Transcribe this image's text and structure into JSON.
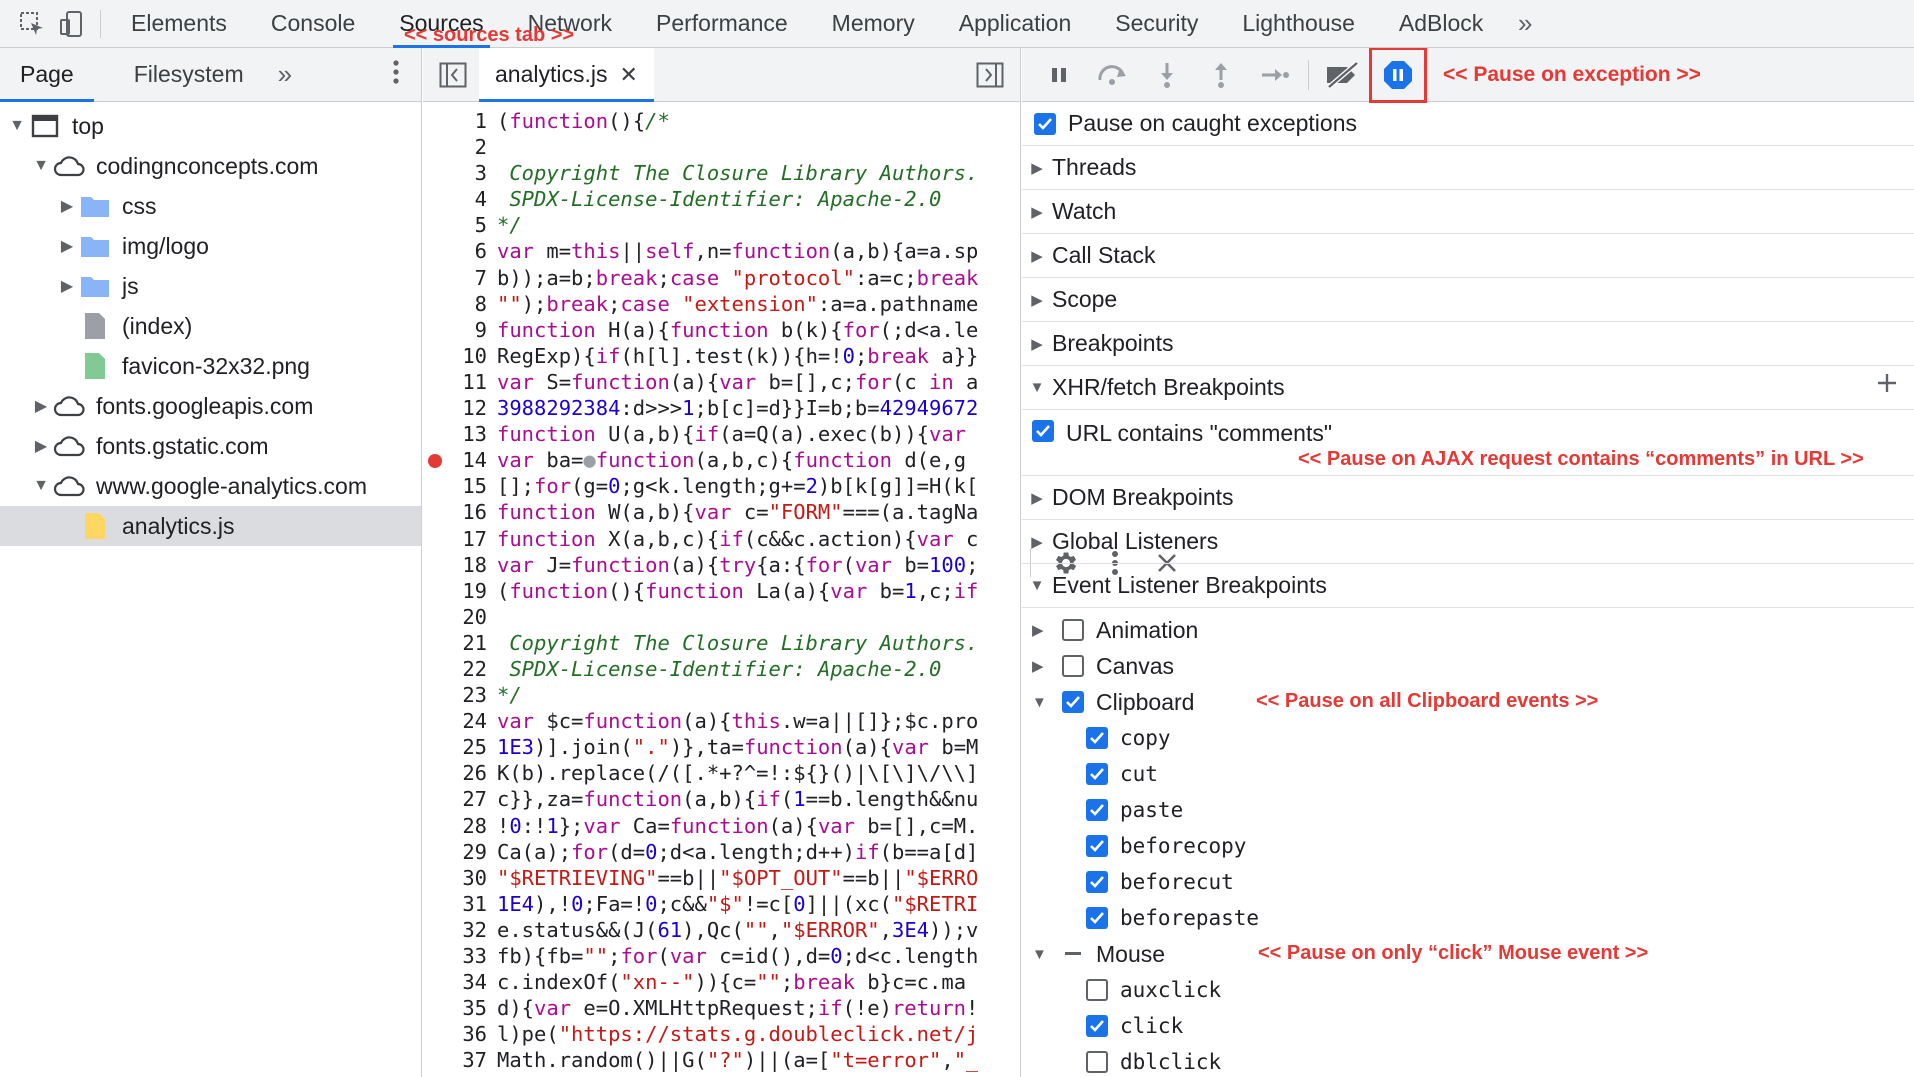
{
  "toolbar": {
    "tabs": [
      "Elements",
      "Console",
      "Sources",
      "Network",
      "Performance",
      "Memory",
      "Application",
      "Security",
      "Lighthouse",
      "AdBlock"
    ],
    "active_tab": "Sources"
  },
  "annotations": {
    "sources_tab": "<< sources tab >>",
    "pause_exception": "<< Pause on exception >>",
    "ajax": "<< Pause on AJAX request contains “comments” in URL >>",
    "clipboard": "<< Pause on all Clipboard events >>",
    "mouse": "<< Pause on only “click” Mouse event >>"
  },
  "navigator": {
    "tabs": [
      "Page",
      "Filesystem"
    ],
    "tree": [
      {
        "label": "top"
      },
      {
        "label": "codingnconcepts.com"
      },
      {
        "label": "css"
      },
      {
        "label": "img/logo"
      },
      {
        "label": "js"
      },
      {
        "label": "(index)"
      },
      {
        "label": "favicon-32x32.png"
      },
      {
        "label": "fonts.googleapis.com"
      },
      {
        "label": "fonts.gstatic.com"
      },
      {
        "label": "www.google-analytics.com"
      },
      {
        "label": "analytics.js"
      }
    ]
  },
  "editor": {
    "file_tab": "analytics.js",
    "lines": [
      "(function(){/*",
      "",
      " Copyright The Closure Library Authors.",
      " SPDX-License-Identifier: Apache-2.0",
      "*/",
      "var m=this||self,n=function(a,b){a=a.sp",
      "b));a=b;break;case \"protocol\":a=c;break",
      "\"\");break;case \"extension\":a=a.pathname",
      "function H(a){function b(k){for(;d<a.le",
      "RegExp){if(h[l].test(k)){h=!0;break a}}",
      "var S=function(a){var b=[],c;for(c in a",
      "3988292384:d>>>1;b[c]=d}}I=b;b=42949672",
      "function U(a,b){if(a=Q(a).exec(b)){var ",
      "var ba=●function(a,b,c){function d(e,g",
      "[];for(g=0;g<k.length;g+=2)b[k[g]]=H(k[",
      "function W(a,b){var c=\"FORM\"===(a.tagNa",
      "function X(a,b,c){if(c&&c.action){var c",
      "var J=function(a){try{a:{for(var b=100;",
      "(function(){function La(a){var b=1,c;if",
      "",
      " Copyright The Closure Library Authors.",
      " SPDX-License-Identifier: Apache-2.0",
      "*/",
      "var $c=function(a){this.w=a||[]};$c.pro",
      "1E3)].join(\".\")},ta=function(a){var b=M",
      "K(b).replace(/([.*+?^=!:${}()|\\[\\]\\/\\\\]",
      "c}},za=function(a,b){if(1==b.length&&nu",
      "!0:!1};var Ca=function(a){var b=[],c=M.",
      "Ca(a);for(d=0;d<a.length;d++)if(b==a[d]",
      "\"$RETRIEVING\"==b||\"$OPT_OUT\"==b||\"$ERRO",
      "1E4),!0;Fa=!0;c&&\"$\"!=c[0]||(xc(\"$RETRI",
      "e.status&&(J(61),Qc(\"\",\"$ERROR\",3E4));v",
      "fb){fb=\"\";for(var c=id(),d=0;d<c.length",
      "c.indexOf(\"xn--\")){c=\"\";break b}c=c.ma",
      "d){var e=O.XMLHttpRequest;if(!e)return!",
      "l)pe(\"https://stats.g.doubleclick.net/j",
      "Math.random()||G(\"?\")||(a=[\"t=error\",\"_"
    ]
  },
  "debugger": {
    "pause_caught": "Pause on caught exceptions",
    "sections": {
      "threads": "Threads",
      "watch": "Watch",
      "call_stack": "Call Stack",
      "scope": "Scope",
      "breakpoints": "Breakpoints",
      "xhr": "XHR/fetch Breakpoints",
      "dom": "DOM Breakpoints",
      "global": "Global Listeners",
      "event": "Event Listener Breakpoints"
    },
    "xhr_entry": "URL contains \"comments\"",
    "categories": {
      "animation": "Animation",
      "canvas": "Canvas",
      "clipboard": "Clipboard",
      "mouse": "Mouse"
    },
    "clipboard_events": [
      "copy",
      "cut",
      "paste",
      "beforecopy",
      "beforecut",
      "beforepaste"
    ],
    "mouse_events": [
      {
        "label": "auxclick",
        "checked": false
      },
      {
        "label": "click",
        "checked": true
      },
      {
        "label": "dblclick",
        "checked": false
      }
    ]
  }
}
